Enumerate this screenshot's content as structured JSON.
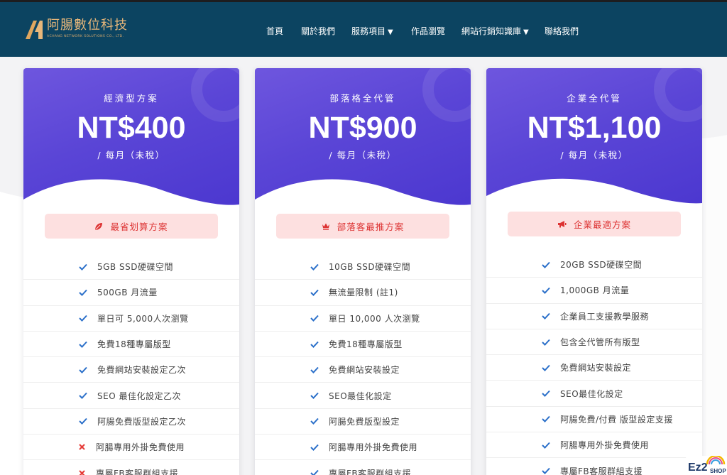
{
  "brand": {
    "name": "阿腸數位科技",
    "subtitle": "ACHANG NETWORK SOLUTIONS CO., LTD."
  },
  "nav": [
    {
      "label": "首頁",
      "has_dropdown": false
    },
    {
      "label": "關於我們",
      "has_dropdown": false
    },
    {
      "label": "服務項目",
      "has_dropdown": true
    },
    {
      "label": "作品瀏覽",
      "has_dropdown": false
    },
    {
      "label": "網站行銷知識庫",
      "has_dropdown": true
    },
    {
      "label": "聯絡我們",
      "has_dropdown": false
    }
  ],
  "dropdown_arrow": "▼",
  "colors": {
    "header_bg": "#0c4461",
    "card_gradient_start": "#6e56de",
    "card_gradient_end": "#4a36cf",
    "badge_bg": "#fde0e0",
    "badge_text": "#dd3333",
    "check": "#2a6fc9",
    "cross": "#e53935"
  },
  "plans": [
    {
      "name": "經濟型方案",
      "price": "NT$400",
      "period": "/ 每月（未稅）",
      "badge_icon": "leaf-icon",
      "badge": "最省划算方案",
      "features": [
        {
          "text": "5GB SSD硬碟空間",
          "included": true
        },
        {
          "text": "500GB 月流量",
          "included": true
        },
        {
          "text": "單日可 5,000人次瀏覽",
          "included": true
        },
        {
          "text": "免費18種專屬版型",
          "included": true
        },
        {
          "text": "免費網站安裝設定乙次",
          "included": true
        },
        {
          "text": "SEO 最佳化設定乙次",
          "included": true
        },
        {
          "text": "阿腸免費版型設定乙次",
          "included": true
        },
        {
          "text": "阿腸專用外掛免費使用",
          "included": false
        },
        {
          "text": "專屬FB客服群組支援",
          "included": false
        }
      ]
    },
    {
      "name": "部落格全代管",
      "price": "NT$900",
      "period": "/ 每月（未稅）",
      "badge_icon": "crown-icon",
      "badge": "部落客最推方案",
      "features": [
        {
          "text": "10GB SSD硬碟空間",
          "included": true
        },
        {
          "text": "無流量限制 (註1)",
          "included": true
        },
        {
          "text": "單日 10,000 人次瀏覽",
          "included": true
        },
        {
          "text": "免費18種專屬版型",
          "included": true
        },
        {
          "text": "免費網站安裝設定",
          "included": true
        },
        {
          "text": "SEO最佳化設定",
          "included": true
        },
        {
          "text": "阿腸免費版型設定",
          "included": true
        },
        {
          "text": "阿腸專用外掛免費使用",
          "included": true
        },
        {
          "text": "專屬FB客服群組支援",
          "included": true
        }
      ]
    },
    {
      "name": "企業全代管",
      "price": "NT$1,100",
      "period": "/ 每月（未稅）",
      "badge_icon": "megaphone-icon",
      "badge": "企業最適方案",
      "features": [
        {
          "text": "20GB SSD硬碟空間",
          "included": true
        },
        {
          "text": "1,000GB 月流量",
          "included": true
        },
        {
          "text": "企業員工支援教學服務",
          "included": true
        },
        {
          "text": "包含全代管所有版型",
          "included": true
        },
        {
          "text": "免費網站安裝設定",
          "included": true
        },
        {
          "text": "SEO最佳化設定",
          "included": true
        },
        {
          "text": "阿腸免費/付費 版型設定支援",
          "included": true
        },
        {
          "text": "阿腸專用外掛免費使用",
          "included": true
        },
        {
          "text": "專屬FB客服群組支援",
          "included": true
        }
      ]
    }
  ],
  "widget": {
    "logo_text": "Ez2",
    "logo_sub": "SHOP"
  }
}
